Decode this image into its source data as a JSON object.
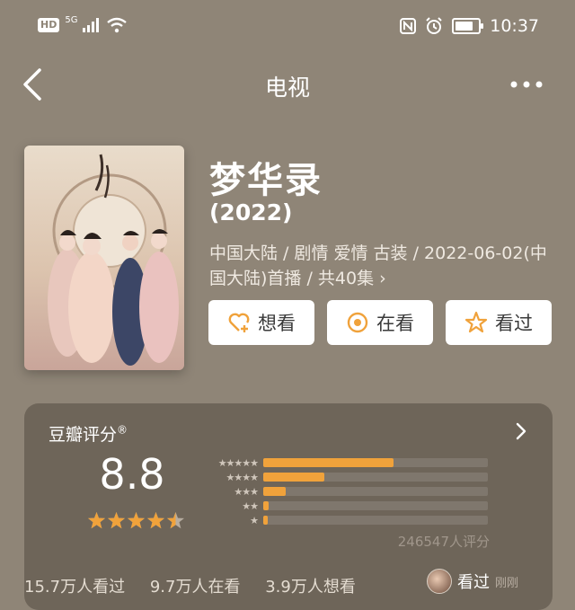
{
  "status_bar": {
    "left_badge": "HD",
    "network": "5G",
    "time": "10:37",
    "battery_level": 0.8
  },
  "nav": {
    "title": "电视",
    "back_icon": "chevron-left-icon",
    "more_icon": "more-dots-icon"
  },
  "show": {
    "title": "梦华录",
    "year": "(2022)",
    "meta": "中国大陆 / 剧情 爱情 古装 / 2022-06-02(中国大陆)首播 / 共40集 ›"
  },
  "actions": [
    {
      "label": "想看",
      "icon": "heart-plus-icon"
    },
    {
      "label": "在看",
      "icon": "radio-dot-icon"
    },
    {
      "label": "看过",
      "icon": "star-outline-icon"
    }
  ],
  "rating": {
    "label": "豆瓣评分",
    "registered": "®",
    "score": "8.8",
    "stars": 4.5,
    "distribution": [
      {
        "stars": "★★★★★",
        "fraction": 0.58
      },
      {
        "stars": "★★★★",
        "fraction": 0.27
      },
      {
        "stars": "★★★",
        "fraction": 0.1
      },
      {
        "stars": "★★",
        "fraction": 0.025
      },
      {
        "stars": "★",
        "fraction": 0.02
      }
    ],
    "votes": "246547人评分"
  },
  "footer": {
    "watched": "15.7万人看过",
    "watching": "9.7万人在看",
    "want": "3.9万人想看",
    "friend_action": "看过",
    "friend_time": "刚刚"
  },
  "colors": {
    "background": "#8f8577",
    "accent": "#f0a23b"
  }
}
